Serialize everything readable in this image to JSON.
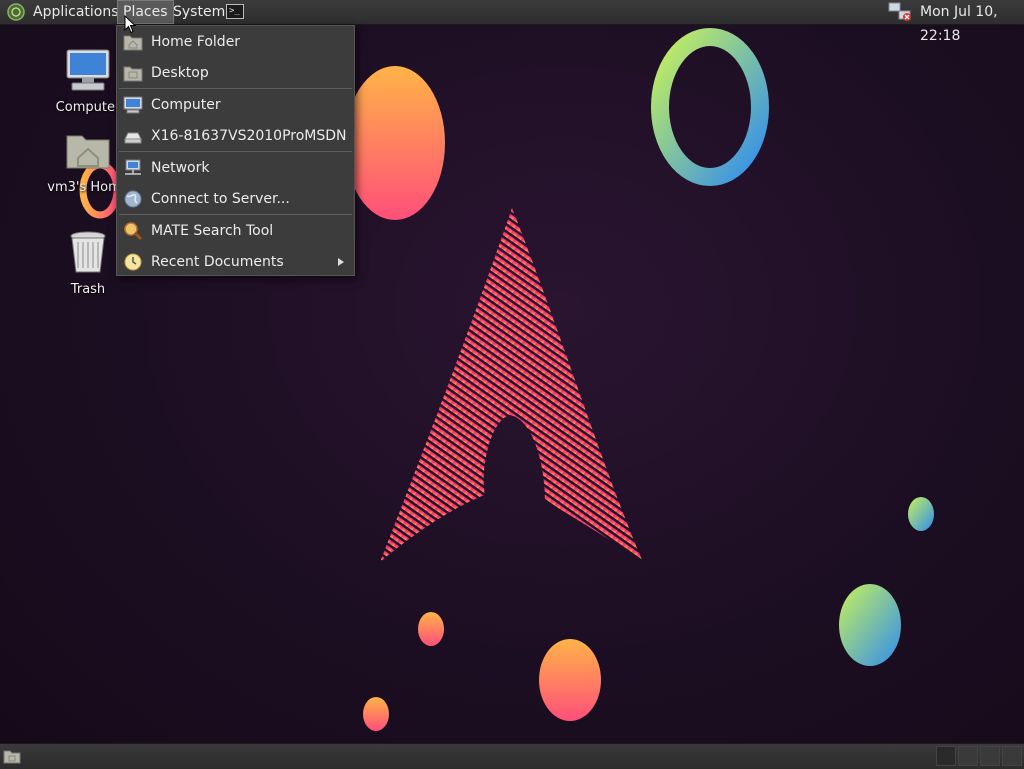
{
  "panel": {
    "menus": [
      "Applications",
      "Places",
      "System"
    ],
    "clock": "Mon Jul 10, 22:18"
  },
  "desktop": {
    "icons": [
      {
        "label": "Computer",
        "icon": "computer-icon"
      },
      {
        "label": "vm3's Home",
        "icon": "home-folder-icon"
      },
      {
        "label": "Trash",
        "icon": "trash-icon"
      }
    ]
  },
  "places_menu": {
    "items": [
      {
        "label": "Home Folder",
        "icon": "home-folder-icon"
      },
      {
        "label": "Desktop",
        "icon": "desktop-folder-icon"
      },
      {
        "label": "Computer",
        "icon": "computer-icon"
      },
      {
        "label": "X16-81637VS2010ProMSDN",
        "icon": "drive-icon"
      },
      {
        "label": "Network",
        "icon": "network-icon"
      },
      {
        "label": "Connect to Server...",
        "icon": "globe-icon"
      },
      {
        "label": "MATE Search Tool",
        "icon": "search-icon"
      },
      {
        "label": "Recent Documents",
        "icon": "clock-icon"
      }
    ]
  },
  "colors": {
    "panel_bg": "#333333",
    "menu_bg": "#3c3c3c",
    "desktop_bg": "#1c0e22",
    "accent_pink": "#e8306f",
    "accent_orange": "#ff8a3a"
  }
}
